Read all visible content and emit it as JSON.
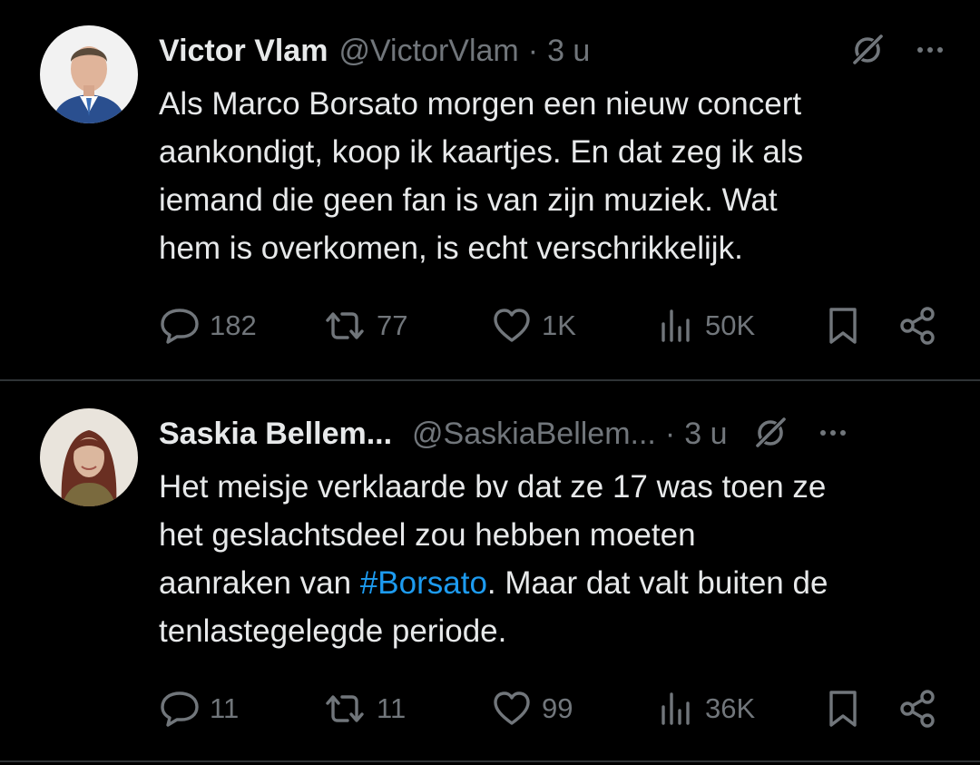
{
  "tweets": [
    {
      "author": {
        "display_name": "Victor Vlam",
        "handle": "@VictorVlam"
      },
      "separator": "·",
      "time": "3 u",
      "text_lines": [
        "Als Marco Borsato morgen een nieuw concert",
        "aankondigt, koop ik kaartjes. En dat zeg ik als",
        "iemand die geen fan is van zijn muziek. Wat",
        "hem is overkomen, is echt verschrikkelijk."
      ],
      "stats": {
        "replies": "182",
        "reposts": "77",
        "likes": "1K",
        "views": "50K"
      }
    },
    {
      "author": {
        "display_name": "Saskia Bellem...",
        "handle": "@SaskiaBellem..."
      },
      "separator": "·",
      "time": "3 u",
      "text": {
        "line1": "Het meisje verklaarde bv dat ze 17 was toen ze",
        "line2": "het geslachtsdeel zou hebben moeten",
        "line3_before": "aanraken van ",
        "hashtag": "#Borsato",
        "line3_after": ". Maar dat valt buiten de",
        "line4": "tenlastegelegde periode."
      },
      "stats": {
        "replies": "11",
        "reposts": "11",
        "likes": "99",
        "views": "36K"
      }
    }
  ],
  "icons": {
    "header": [
      "grok-icon",
      "more-icon"
    ],
    "actions": [
      "reply-icon",
      "repost-icon",
      "like-icon",
      "views-icon",
      "bookmark-icon",
      "share-icon"
    ]
  },
  "colors": {
    "background": "#000000",
    "primary_text": "#e7e9ea",
    "secondary_text": "#71767b",
    "hashtag": "#1d9bf0",
    "divider": "#2f3336"
  }
}
